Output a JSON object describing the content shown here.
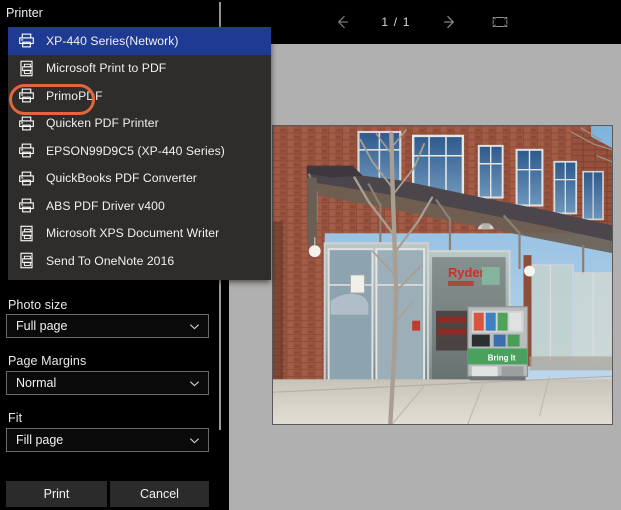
{
  "window": {
    "bg_color": "#000000",
    "accent_selected": "#1f3a93",
    "annotation_color": "#e2663c"
  },
  "printer_section": {
    "label": "Printer",
    "selected_value": "XP-440 Series(Network)",
    "highlighted_item": "PrimoPDF",
    "items": [
      {
        "label": "XP-440 Series(Network)",
        "icon": "printer-icon",
        "selected": true
      },
      {
        "label": "Microsoft Print to PDF",
        "icon": "document-printer-icon",
        "selected": false
      },
      {
        "label": "PrimoPDF",
        "icon": "printer-icon",
        "selected": false
      },
      {
        "label": "Quicken PDF Printer",
        "icon": "printer-icon",
        "selected": false
      },
      {
        "label": "EPSON99D9C5 (XP-440 Series)",
        "icon": "printer-icon",
        "selected": false
      },
      {
        "label": "QuickBooks PDF Converter",
        "icon": "printer-icon",
        "selected": false
      },
      {
        "label": "ABS PDF Driver v400",
        "icon": "printer-icon",
        "selected": false
      },
      {
        "label": "Microsoft XPS Document Writer",
        "icon": "document-printer-icon",
        "selected": false
      },
      {
        "label": "Send To OneNote 2016",
        "icon": "document-printer-icon",
        "selected": false
      }
    ]
  },
  "settings": {
    "photo_size": {
      "label": "Photo size",
      "value": "Full page",
      "chevron": "chevron-down-icon"
    },
    "page_margins": {
      "label": "Page Margins",
      "value": "Normal",
      "chevron": "chevron-down-icon"
    },
    "fit": {
      "label": "Fit",
      "value": "Fill page",
      "chevron": "chevron-down-icon"
    }
  },
  "actions": {
    "print_label": "Print",
    "cancel_label": "Cancel"
  },
  "toolbar": {
    "prev_icon": "arrow-left-icon",
    "next_icon": "arrow-right-icon",
    "page_indicator": "1 / 1",
    "fullscreen_icon": "fit-to-screen-icon"
  },
  "preview": {
    "page_background": "#b0b0b0",
    "photo_alt": "storefront-photo"
  }
}
